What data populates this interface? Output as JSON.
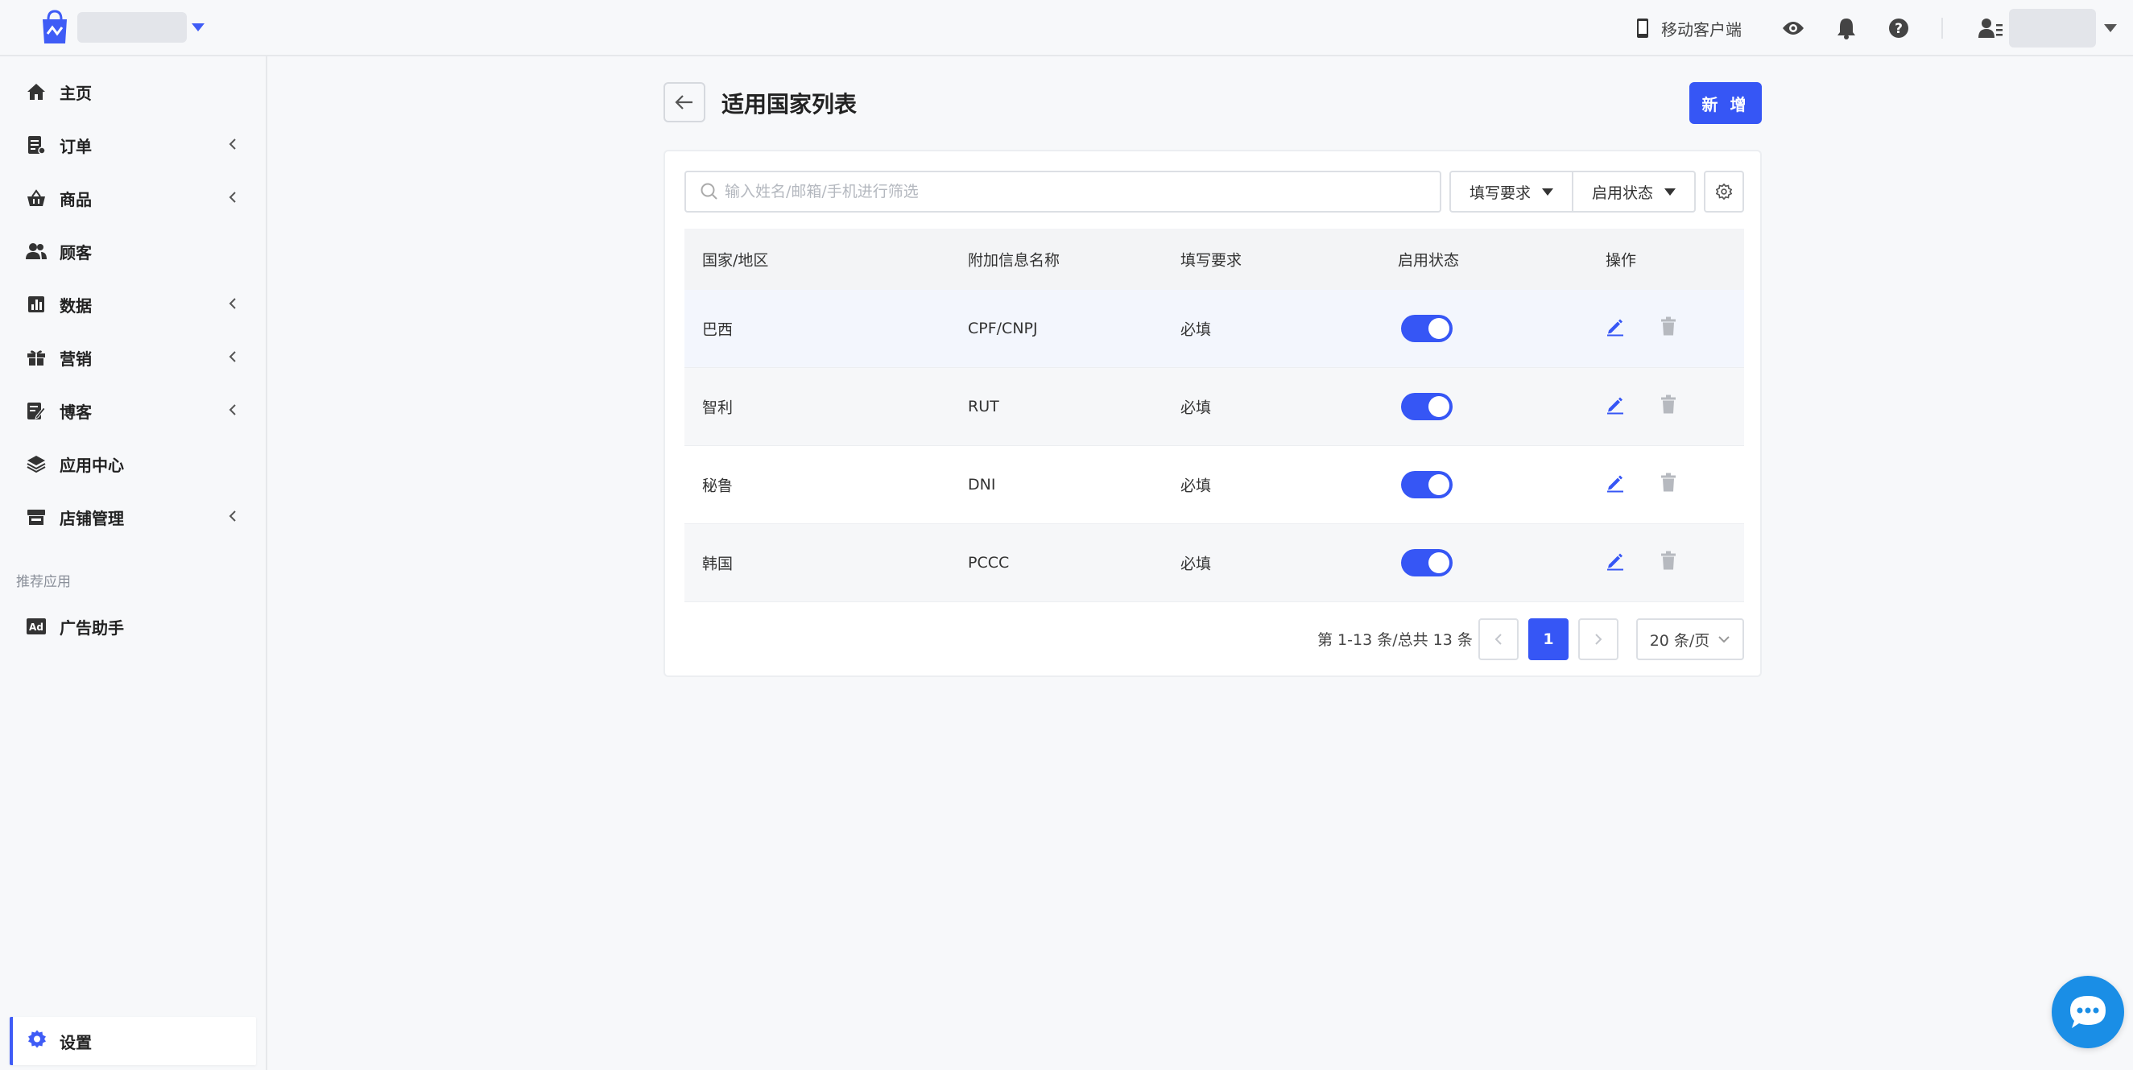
{
  "header": {
    "mobile_label": "移动客户端"
  },
  "sidebar": {
    "items": [
      {
        "label": "主页"
      },
      {
        "label": "订单"
      },
      {
        "label": "商品"
      },
      {
        "label": "顾客"
      },
      {
        "label": "数据"
      },
      {
        "label": "营销"
      },
      {
        "label": "博客"
      },
      {
        "label": "应用中心"
      },
      {
        "label": "店铺管理"
      }
    ],
    "section_label": "推荐应用",
    "recommended": [
      {
        "label": "广告助手"
      }
    ],
    "active": {
      "label": "设置"
    }
  },
  "page": {
    "title": "适用国家列表",
    "add_label": "新 增"
  },
  "filters": {
    "search_placeholder": "输入姓名/邮箱/手机进行筛选",
    "fill_requirement": "填写要求",
    "enable_status": "启用状态"
  },
  "table": {
    "columns": [
      "国家/地区",
      "附加信息名称",
      "填写要求",
      "启用状态",
      "操作"
    ],
    "rows": [
      {
        "country": "巴西",
        "info": "CPF/CNPJ",
        "requirement": "必填",
        "enabled": true
      },
      {
        "country": "智利",
        "info": "RUT",
        "requirement": "必填",
        "enabled": true
      },
      {
        "country": "秘鲁",
        "info": "DNI",
        "requirement": "必填",
        "enabled": true
      },
      {
        "country": "韩国",
        "info": "PCCC",
        "requirement": "必填",
        "enabled": true
      }
    ]
  },
  "pagination": {
    "info": "第 1-13 条/总共 13 条",
    "current_page": "1",
    "page_size": "20 条/页"
  },
  "colors": {
    "accent": "#3656f5",
    "chat": "#1a8ee6"
  }
}
